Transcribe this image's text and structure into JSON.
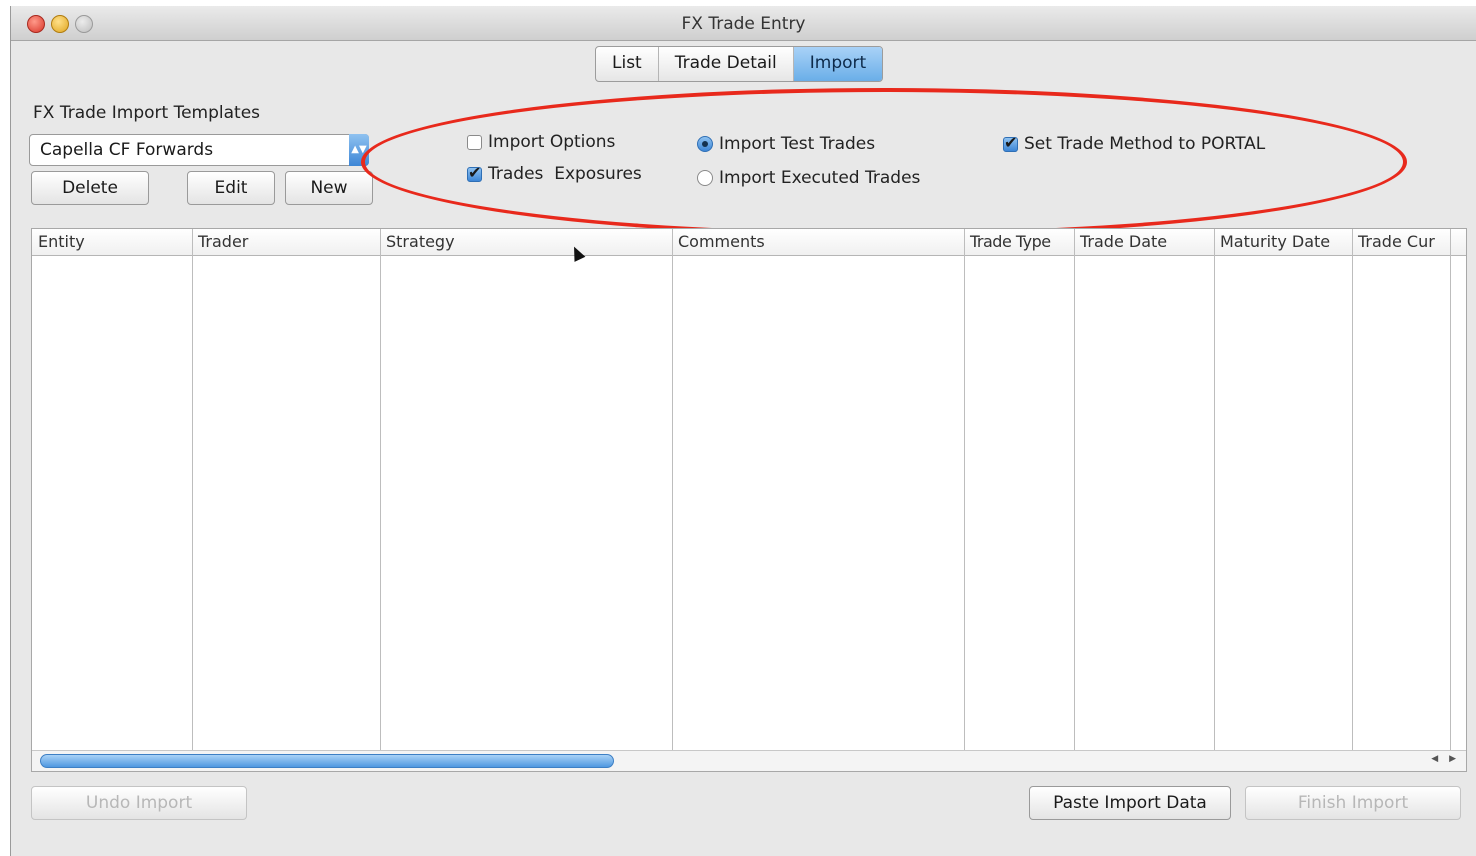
{
  "window": {
    "title": "FX Trade Entry"
  },
  "tabs": [
    {
      "label": "List",
      "active": false
    },
    {
      "label": "Trade Detail",
      "active": false
    },
    {
      "label": "Import",
      "active": true
    }
  ],
  "templates": {
    "label": "FX Trade Import Templates",
    "selected": "Capella CF Forwards",
    "delete_label": "Delete",
    "edit_label": "Edit",
    "new_label": "New"
  },
  "options": {
    "import_options": {
      "label": "Import Options",
      "checked": false
    },
    "trades_exposures": {
      "label": "Trades  Exposures",
      "checked": true
    },
    "import_test_trades": {
      "label": "Import Test Trades",
      "selected": true
    },
    "import_executed_trades": {
      "label": "Import Executed Trades",
      "selected": false
    },
    "set_trade_method": {
      "label": "Set Trade Method to PORTAL",
      "checked": true
    }
  },
  "table": {
    "columns": [
      "Entity",
      "Trader",
      "Strategy",
      "Comments",
      "Trade Type",
      "Trade Date",
      "Maturity Date",
      "Trade Cur"
    ],
    "rows": []
  },
  "footer": {
    "undo_label": "Undo Import",
    "paste_label": "Paste Import Data",
    "finish_label": "Finish Import"
  },
  "colors": {
    "accent": "#6aaee8",
    "highlight": "#e8291c"
  }
}
